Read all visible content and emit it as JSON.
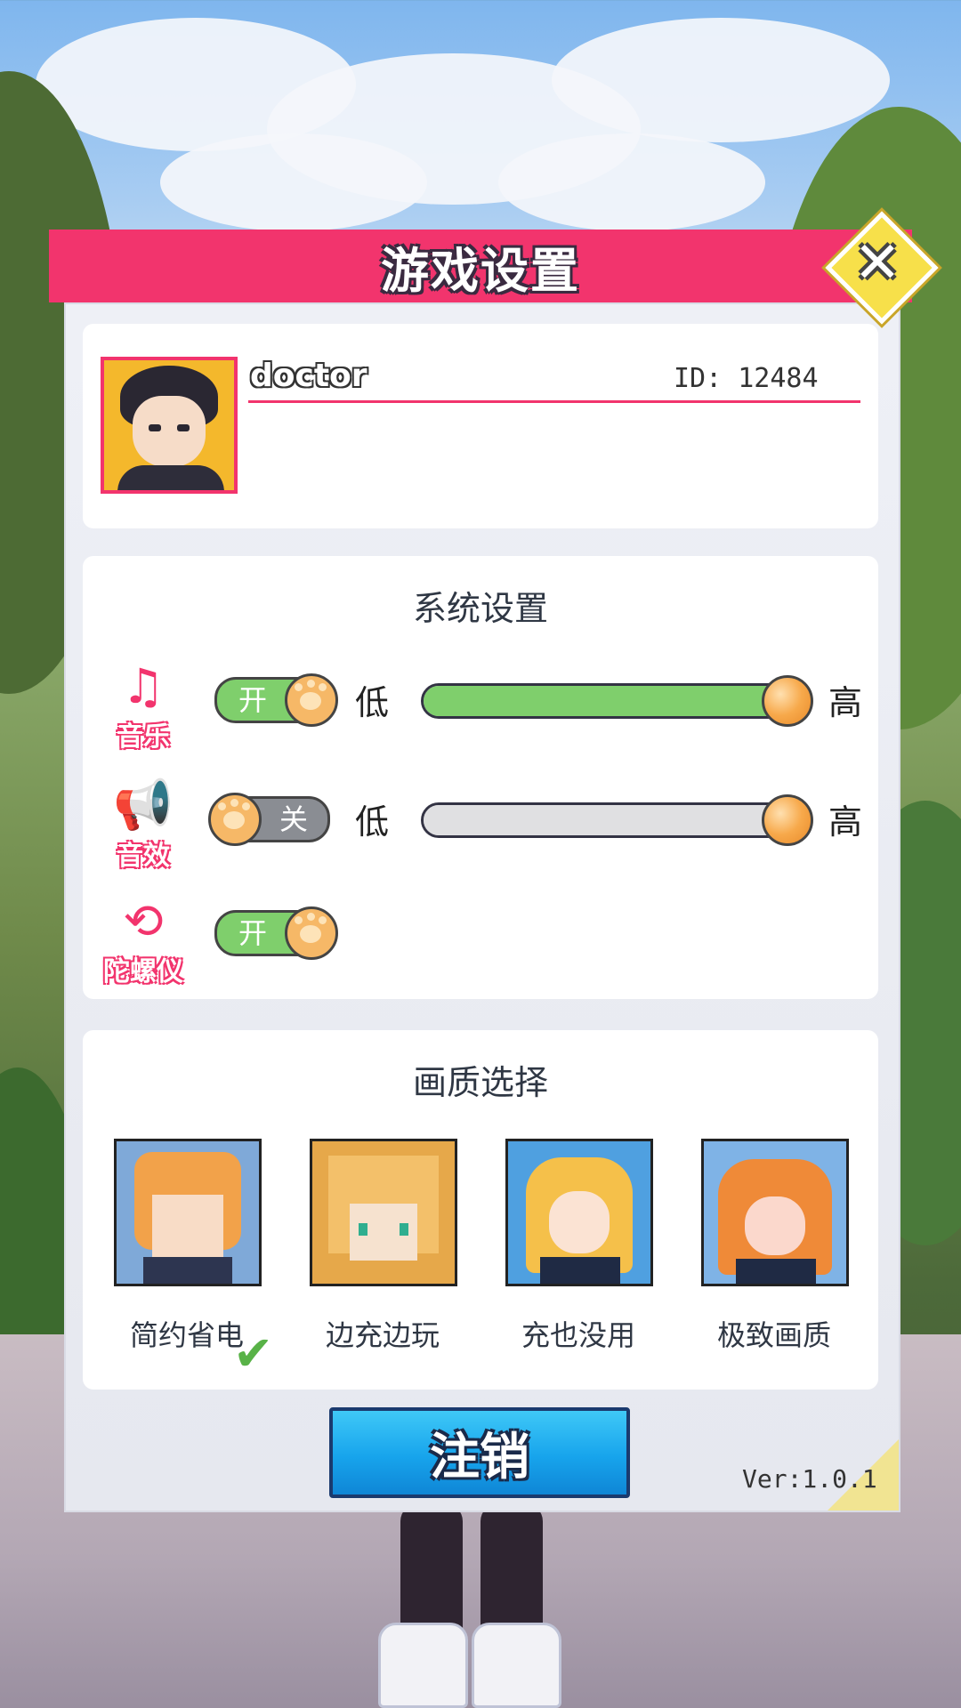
{
  "dialog": {
    "title": "游戏设置",
    "close_icon": "close-icon"
  },
  "profile": {
    "name": "doctor",
    "id_text": "ID: 12484"
  },
  "system_settings": {
    "title": "系统设置",
    "music": {
      "label": "音乐",
      "icon": "music-note-icon",
      "toggle_label": "开",
      "enabled": true,
      "low_label": "低",
      "high_label": "高",
      "level": 1.0
    },
    "sound_effects": {
      "label": "音效",
      "icon": "speaker-icon",
      "toggle_label": "关",
      "enabled": false,
      "low_label": "低",
      "high_label": "高",
      "level": 1.0
    },
    "gyroscope": {
      "label": "陀螺仪",
      "icon": "gyroscope-icon",
      "toggle_label": "开",
      "enabled": true
    }
  },
  "quality": {
    "title": "画质选择",
    "options": [
      {
        "label": "简约省电",
        "selected": true
      },
      {
        "label": "边充边玩",
        "selected": false
      },
      {
        "label": "充也没用",
        "selected": false
      },
      {
        "label": "极致画质",
        "selected": false
      }
    ]
  },
  "footer": {
    "logout_label": "注销",
    "version": "Ver:1.0.1"
  },
  "colors": {
    "accent_pink": "#f2346d",
    "toggle_on": "#7fcf6c",
    "button_blue": "#17a4ec"
  }
}
